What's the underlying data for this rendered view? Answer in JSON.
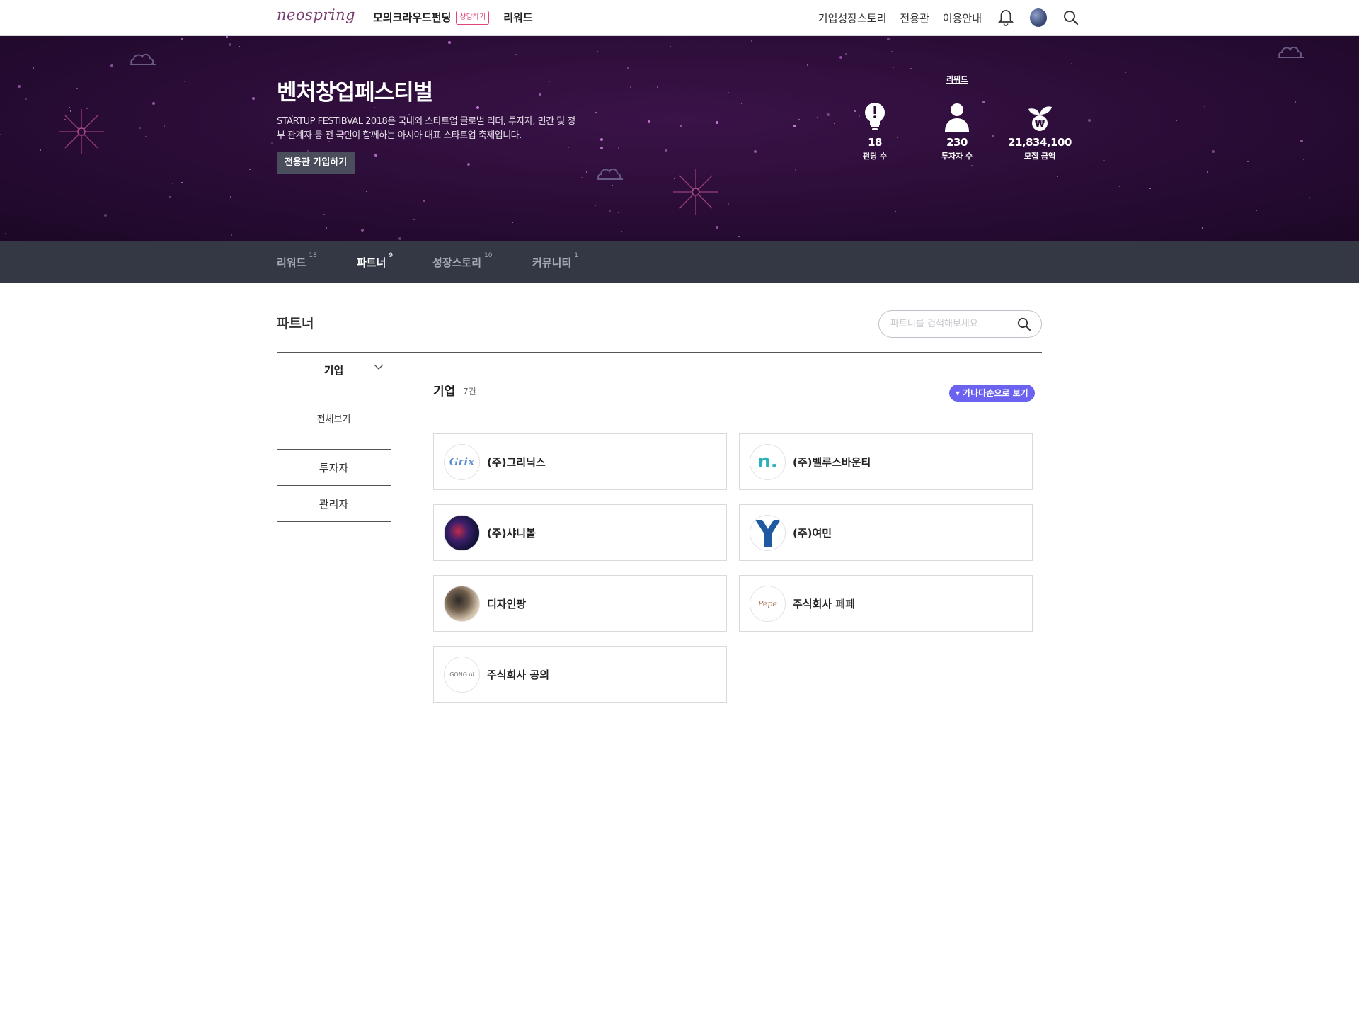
{
  "nav": {
    "logo": "neospring",
    "links": [
      "모의크라우드펀딩",
      "리워드"
    ],
    "badge": "상담하기",
    "right_links": [
      "기업성장스토리",
      "전용관",
      "이용안내"
    ]
  },
  "hero": {
    "title": "벤처창업페스티벌",
    "description": "STARTUP FESTIBVAL 2018은 국내외 스타트업 글로벌 리더, 투자자, 민간 및 정부 관계자 등 전 국민이 함께하는 아시아 대표 스타트업 축제입니다.",
    "join_button": "전용관 가입하기",
    "stats_heading": "리워드",
    "stats": [
      {
        "value": "18",
        "label": "펀딩 수",
        "icon": "lightbulb-icon"
      },
      {
        "value": "230",
        "label": "투자자 수",
        "icon": "person-icon"
      },
      {
        "value": "21,834,100",
        "label": "모집 금액",
        "icon": "won-sprout-icon"
      }
    ],
    "background_color": "#2a0c36"
  },
  "tabs": [
    {
      "label": "리워드",
      "count": "18",
      "active": false
    },
    {
      "label": "파트너",
      "count": "9",
      "active": true
    },
    {
      "label": "성장스토리",
      "count": "10",
      "active": false
    },
    {
      "label": "커뮤니티",
      "count": "1",
      "active": false
    }
  ],
  "main": {
    "title": "파트너",
    "search_placeholder": "파트너를 검색해보세요",
    "sidebar": {
      "category": "기업",
      "sub_item": "전체보기",
      "items": [
        "투자자",
        "관리자"
      ]
    },
    "list": {
      "heading": "기업",
      "count": "7건",
      "sort_button": "▾ 가나다순으로 보기",
      "accent_color": "#6b63f0",
      "companies": [
        {
          "name": "(주)그리닉스",
          "logo_text": "Grix"
        },
        {
          "name": "(주)벨루스바운티",
          "logo_text": "n."
        },
        {
          "name": "(주)샤니볼",
          "logo_text": ""
        },
        {
          "name": "(주)여민",
          "logo_text": "Y"
        },
        {
          "name": "디자인팡",
          "logo_text": ""
        },
        {
          "name": "주식회사 페페",
          "logo_text": "Pepe"
        },
        {
          "name": "주식회사 공의",
          "logo_text": "GONG ui"
        }
      ]
    }
  }
}
